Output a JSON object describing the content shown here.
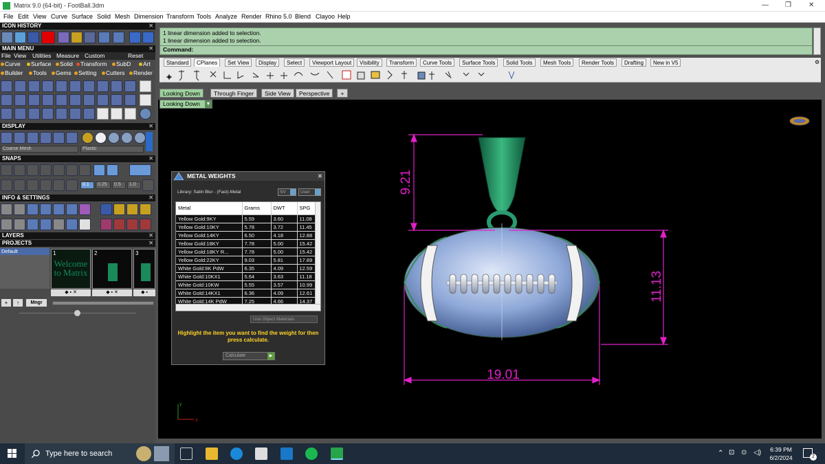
{
  "window": {
    "title": "Matrix 9.0 (64-bit) - FootBall.3dm"
  },
  "menubar": [
    "File",
    "Edit",
    "View",
    "Curve",
    "Surface",
    "Solid",
    "Mesh",
    "Dimension",
    "Transform",
    "Tools",
    "Analyze",
    "Render",
    "Rhino 5.0",
    "Blend",
    "Clayoo",
    "Help"
  ],
  "panels": {
    "icon_history": "ICON HISTORY",
    "main_menu": "MAIN MENU",
    "main_menu_items": [
      "File",
      "View",
      "Utilities",
      "Measure",
      "Custom"
    ],
    "main_menu_reset": "Reset",
    "categories_row1": [
      "Curve",
      "Surface",
      "Solid",
      "Transform",
      "SubD",
      "Art"
    ],
    "categories_row2": [
      "Builder",
      "Tools",
      "Gems",
      "Setting",
      "Cutters",
      "Render"
    ],
    "display": "DISPLAY",
    "display_mesh": "Coarse Mesh",
    "display_material": "Plastic",
    "snaps": "SNAPS",
    "snap_values": [
      "0.1",
      "0.25",
      "0.5",
      "1.0"
    ],
    "info": "INFO & SETTINGS",
    "layers": "LAYERS",
    "projects": "PROJECTS",
    "project_default": "Default",
    "thumbs": [
      "1",
      "2",
      "3"
    ],
    "thumb_text": "Welcome to Matrix",
    "mngr": "Mngr"
  },
  "command": {
    "line1": "1 linear dimension added to selection.",
    "line2": "1 linear dimension added to selection.",
    "prompt": "Command:"
  },
  "toolbar_tabs": [
    "Standard",
    "CPlanes",
    "Set View",
    "Display",
    "Select",
    "Viewport Layout",
    "Visibility",
    "Transform",
    "Curve Tools",
    "Surface Tools",
    "Solid Tools",
    "Mesh Tools",
    "Render Tools",
    "Drafting",
    "New in V5"
  ],
  "viewport_tabs": [
    "Looking Down",
    "Through Finger",
    "Side View",
    "Perspective"
  ],
  "viewport_add": "+",
  "viewport_dropdown": "Looking Down",
  "dimensions": {
    "height_top": "9.21",
    "height_right": "11.13",
    "width": "19.01"
  },
  "axis": {
    "x": "x",
    "y": "y"
  },
  "metal_weights": {
    "title": "METAL WEIGHTS",
    "library": "Library: Satin Blur - (Fast)-Metal",
    "switch_left": "SV",
    "switch_right": "User",
    "columns": [
      "Metal",
      "Grams",
      "DWT",
      "SPG"
    ],
    "rows": [
      [
        "Yellow Gold:9KY",
        "5.59",
        "3.60",
        "11.08"
      ],
      [
        "Yellow Gold:10KY",
        "5.78",
        "3.72",
        "11.45"
      ],
      [
        "Yellow Gold:14KY",
        "6.50",
        "4.18",
        "12.88"
      ],
      [
        "Yellow Gold:18KY",
        "7.78",
        "5.00",
        "15.42"
      ],
      [
        "Yellow Gold:18KY R...",
        "7.78",
        "5.00",
        "15.42"
      ],
      [
        "Yellow Gold:22KY",
        "9.03",
        "5.81",
        "17.89"
      ],
      [
        "White Gold:9K PdW",
        "6.35",
        "4.09",
        "12.59"
      ],
      [
        "White Gold:10KX1",
        "5.64",
        "3.63",
        "11.18"
      ],
      [
        "White Gold:10KW",
        "5.55",
        "3.57",
        "10.99"
      ],
      [
        "White Gold:14KX1",
        "6.36",
        "4.09",
        "12.61"
      ],
      [
        "White Gold:14K PdW",
        "7.25",
        "4.66",
        "14.37"
      ]
    ],
    "use_object": "Use Object Materials",
    "note": "Highlight the item you want to find the weight for then press calculate.",
    "calculate": "Calculate"
  },
  "taskbar": {
    "search_placeholder": "Type here to search",
    "time": "6:39 PM",
    "date": "6/2/2024",
    "notifications": "2"
  },
  "colors": {
    "accent_green": "#9ed19e",
    "dimension_magenta": "#e020c8",
    "command_bg": "#aad0ac",
    "panel_bg": "#4a4a4a",
    "taskbar": "#1d2b3a"
  }
}
